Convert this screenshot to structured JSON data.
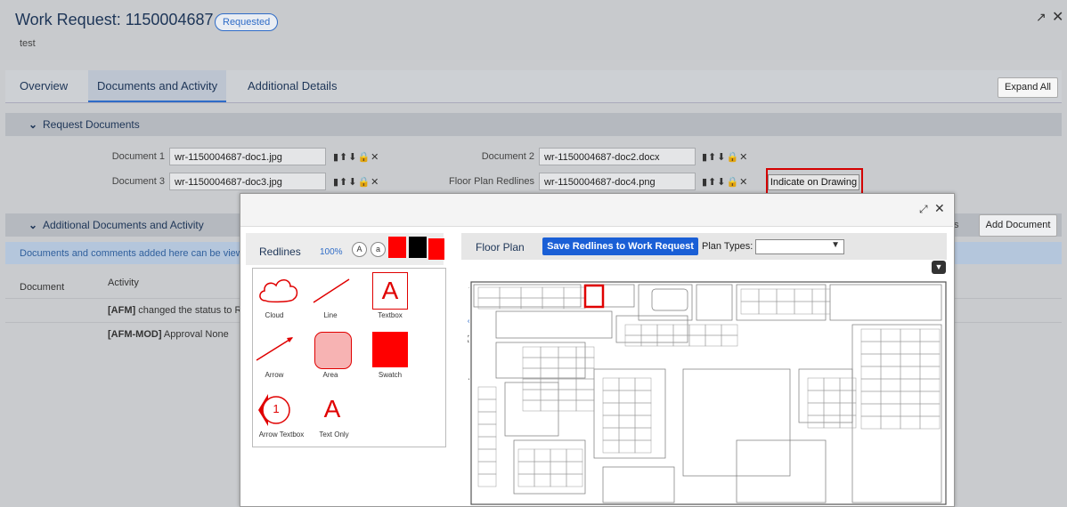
{
  "header": {
    "title": "Work Request: 1150004687",
    "status_badge": "Requested",
    "subtitle": "test",
    "expand_icon": "↗",
    "close_icon": "✕"
  },
  "tabs": [
    {
      "label": "Overview"
    },
    {
      "label": "Documents and Activity"
    },
    {
      "label": "Additional Details"
    }
  ],
  "expand_all_label": "Expand All",
  "request_documents": {
    "section_title": "Request Documents",
    "docs": [
      {
        "label": "Document 1",
        "value": "wr-1150004687-doc1.jpg"
      },
      {
        "label": "Document 2",
        "value": "wr-1150004687-doc2.docx"
      },
      {
        "label": "Document 3",
        "value": "wr-1150004687-doc3.jpg"
      },
      {
        "label": "Floor Plan Redlines",
        "value": "wr-1150004687-doc4.png"
      }
    ],
    "indicate_label": "Indicate on Drawing"
  },
  "additional": {
    "section_title": "Additional Documents and Activity",
    "add_document_label": "Add Document",
    "partial_button_label": "ts",
    "info_text": "Documents and comments added here can be view",
    "col_document": "Document",
    "col_activity": "Activity",
    "rows": [
      {
        "bold": "[AFM]",
        "text": " changed the status to Re"
      },
      {
        "bold": "[AFM-MOD]",
        "text": " Approval None"
      }
    ]
  },
  "modal": {
    "redlines_title": "Redlines",
    "zoom": "100%",
    "font_large": "A",
    "font_small": "a",
    "swatch_colors": [
      "#ff0000",
      "#000000",
      "#ff0000"
    ],
    "tools": [
      {
        "label": "Cloud"
      },
      {
        "label": "Line"
      },
      {
        "label": "Textbox"
      },
      {
        "label": "Arrow"
      },
      {
        "label": "Area"
      },
      {
        "label": "Swatch"
      },
      {
        "label": "Arrow Textbox"
      },
      {
        "label": "Text Only"
      }
    ],
    "arrow_textbox_number": "1",
    "textbox_glyph": "A",
    "floor_plan_title": "Floor Plan",
    "save_label": "Save Redlines to Work Request",
    "plan_types_label": "Plan Types:",
    "plan_types_value": "",
    "accent": "#1a5fd6",
    "redline_color": "#ff0000"
  }
}
